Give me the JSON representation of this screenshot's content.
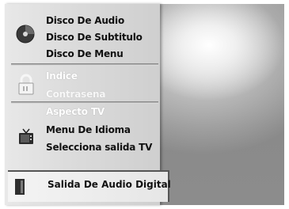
{
  "menu": {
    "groups": [
      {
        "icon": "disc-icon",
        "items": [
          {
            "label": "Disco De Audio"
          },
          {
            "label": "Disco De Subtitulo"
          },
          {
            "label": "Disco De Menu"
          }
        ]
      },
      {
        "icon": "padlock-icon",
        "items": [
          {
            "label": "Indice"
          },
          {
            "label": "Contrasena"
          }
        ]
      },
      {
        "icon": "tv-icon",
        "items": [
          {
            "label": "Aspecto TV"
          },
          {
            "label": "Menu De Idioma"
          },
          {
            "label": "Selecciona salida TV"
          }
        ]
      }
    ],
    "selected": {
      "icon": "audio-output-icon",
      "label": "Salida De Audio Digital"
    }
  }
}
